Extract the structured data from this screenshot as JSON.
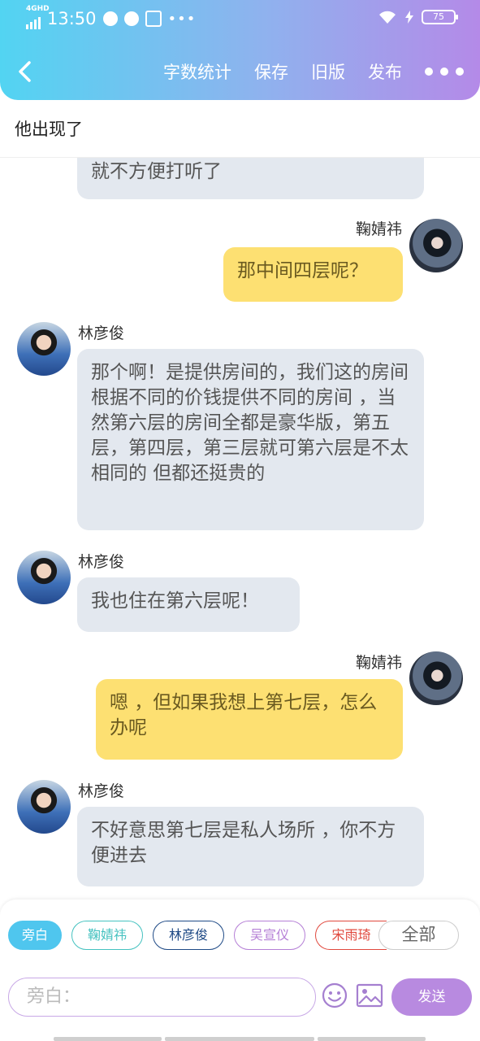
{
  "status_bar": {
    "network": "4GHD",
    "time": "13:50",
    "battery": "75"
  },
  "header": {
    "actions": [
      "字数统计",
      "保存",
      "旧版",
      "发布"
    ]
  },
  "chapter_title": "他出现了",
  "messages": [
    {
      "side": "left",
      "text": "就不方便打听了"
    },
    {
      "side": "right",
      "sender": "鞠婧祎",
      "text": "那中间四层呢？"
    },
    {
      "side": "left",
      "sender": "林彦俊",
      "text": "那个啊！是提供房间的，我们这的房间根据不同的价钱提供不同的房间 ，当然第六层的房间全都是豪华版，第五层，第四层，第三层就可第六层是不太相同的 但都还挺贵的"
    },
    {
      "side": "left",
      "sender": "林彦俊",
      "text": "我也住在第六层呢！"
    },
    {
      "side": "right",
      "sender": "鞠婧祎",
      "text": "嗯 ，但如果我想上第七层，怎么办呢"
    },
    {
      "side": "left",
      "sender": "林彦俊",
      "text": "不好意思第七层是私人场所 ，你不方便进去"
    }
  ],
  "role_chips": [
    {
      "label": "旁白",
      "color": "#4fc6ee",
      "selected": true
    },
    {
      "label": "鞠婧祎",
      "color": "#45c2c0"
    },
    {
      "label": "林彦俊",
      "color": "#1f4a86"
    },
    {
      "label": "吴宣仪",
      "color": "#b57fd6"
    },
    {
      "label": "宋雨琦",
      "color": "#e0483d"
    },
    {
      "label": "全部",
      "color": "#cccccc"
    }
  ],
  "input": {
    "placeholder": "旁白："
  },
  "send_label": "发送"
}
